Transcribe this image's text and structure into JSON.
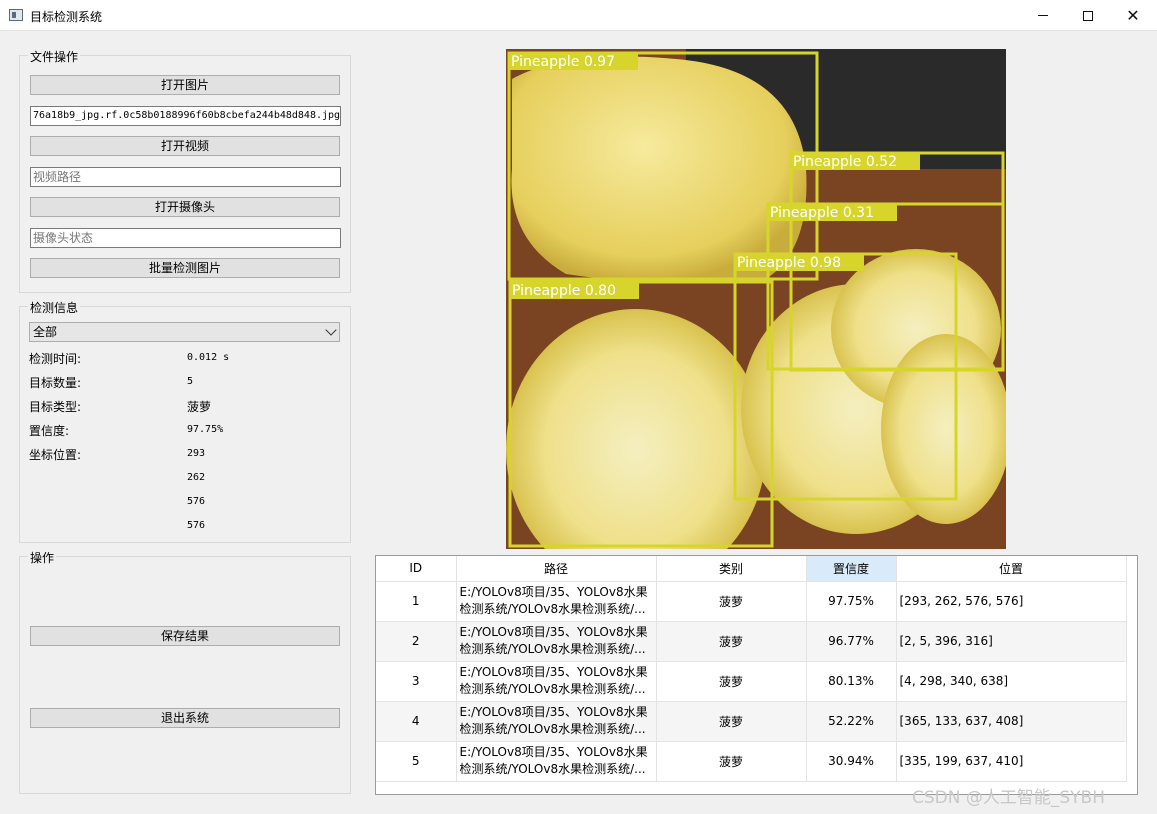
{
  "window": {
    "title": "目标检测系统"
  },
  "file_ops": {
    "group_title": "文件操作",
    "open_image": "打开图片",
    "image_path": "76a18b9_jpg.rf.0c58b0188996f60b8cbefa244b48d848.jpg",
    "open_video": "打开视频",
    "video_placeholder": "视频路径",
    "open_camera": "打开摄像头",
    "camera_placeholder": "摄像头状态",
    "batch_detect": "批量检测图片"
  },
  "detect_info": {
    "group_title": "检测信息",
    "filter_selected": "全部",
    "time_label": "检测时间:",
    "time_value": "0.012 s",
    "count_label": "目标数量:",
    "count_value": "5",
    "type_label": "目标类型:",
    "type_value": "菠萝",
    "conf_label": "置信度:",
    "conf_value": "97.75%",
    "coord_label": "坐标位置:",
    "coords": [
      "293",
      "262",
      "576",
      "576"
    ]
  },
  "ops": {
    "group_title": "操作",
    "save": "保存结果",
    "exit": "退出系统"
  },
  "detections": [
    {
      "label": "Pineapple 0.97"
    },
    {
      "label": "Pineapple 0.52"
    },
    {
      "label": "Pineapple 0.31"
    },
    {
      "label": "Pineapple 0.98"
    },
    {
      "label": "Pineapple 0.80"
    }
  ],
  "box_color": "#d7d52c",
  "table": {
    "headers": [
      "ID",
      "路径",
      "类别",
      "置信度",
      "位置"
    ],
    "rows": [
      {
        "id": "1",
        "path1": "E:/YOLOv8项目/35、YOLOv8水果",
        "path2": "检测系统/YOLOv8水果检测系统/...",
        "cls": "菠萝",
        "conf": "97.75%",
        "pos": "[293, 262, 576, 576]"
      },
      {
        "id": "2",
        "path1": "E:/YOLOv8项目/35、YOLOv8水果",
        "path2": "检测系统/YOLOv8水果检测系统/...",
        "cls": "菠萝",
        "conf": "96.77%",
        "pos": "[2, 5, 396, 316]"
      },
      {
        "id": "3",
        "path1": "E:/YOLOv8项目/35、YOLOv8水果",
        "path2": "检测系统/YOLOv8水果检测系统/...",
        "cls": "菠萝",
        "conf": "80.13%",
        "pos": "[4, 298, 340, 638]"
      },
      {
        "id": "4",
        "path1": "E:/YOLOv8项目/35、YOLOv8水果",
        "path2": "检测系统/YOLOv8水果检测系统/...",
        "cls": "菠萝",
        "conf": "52.22%",
        "pos": "[365, 133, 637, 408]"
      },
      {
        "id": "5",
        "path1": "E:/YOLOv8项目/35、YOLOv8水果",
        "path2": "检测系统/YOLOv8水果检测系统/...",
        "cls": "菠萝",
        "conf": "30.94%",
        "pos": "[335, 199, 637, 410]"
      }
    ]
  },
  "watermark": "CSDN @人工智能_SYBH"
}
